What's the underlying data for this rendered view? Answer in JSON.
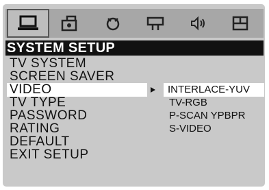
{
  "icons": [
    {
      "name": "general-setup-icon",
      "active": true
    },
    {
      "name": "audio-setup-icon",
      "active": false
    },
    {
      "name": "dolby-setup-icon",
      "active": false
    },
    {
      "name": "video-setup-icon",
      "active": false
    },
    {
      "name": "speaker-setup-icon",
      "active": false
    },
    {
      "name": "preference-setup-icon",
      "active": false
    }
  ],
  "header": {
    "title": "SYSTEM SETUP"
  },
  "menu": {
    "items": [
      {
        "label": "TV SYSTEM"
      },
      {
        "label": "SCREEN SAVER"
      },
      {
        "label": "VIDEO",
        "selected": true
      },
      {
        "label": "TV TYPE"
      },
      {
        "label": "PASSWORD"
      },
      {
        "label": "RATING"
      },
      {
        "label": "DEFAULT"
      },
      {
        "label": "EXIT SETUP"
      }
    ]
  },
  "submenu": {
    "items": [
      {
        "label": "INTERLACE-YUV",
        "selected": true
      },
      {
        "label": "TV-RGB"
      },
      {
        "label": "P-SCAN YPBPR"
      },
      {
        "label": "S-VIDEO"
      }
    ]
  },
  "colors": {
    "background": "#c9c9c9",
    "iconbar": "#a7a7a7",
    "header": "#111111",
    "highlight": "#ffffff"
  }
}
